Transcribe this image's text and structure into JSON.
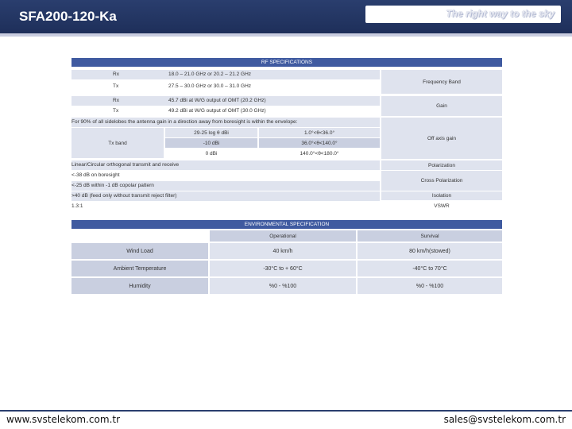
{
  "header": {
    "title": "SFA200-120-Ka",
    "slogan": "The right way to the sky"
  },
  "rf": {
    "section_title": "RF SPECIFICATIONS",
    "rx_label": "Rx",
    "rx_value": "18.0 – 21.0 GHz or 20.2 – 21.2 GHz",
    "tx_label": "Tx",
    "tx_value": "27.5 – 30.0 GHz or 30.0 – 31.0 GHz",
    "freq_band": "Frequency Band",
    "gain_rx_label": "Rx",
    "gain_rx_value": "45.7 dBi at W/G output of OMT (20.2 GHz)",
    "gain_tx_label": "Tx",
    "gain_tx_value": "49.2 dBi at W/G output of OMT (30.0 GHz)",
    "gain": "Gain",
    "envelope_note": "For 90% of all sidelobes the antenna gain in a direction away from boresight is within the envelope:",
    "tx_band": "Tx band",
    "env1_gain": "29-25 log θ dBi",
    "env1_angle": "1.0°<θ<36.0°",
    "env2_gain": "-10 dBi",
    "env2_angle": "36.0°<θ<140.0°",
    "env3_gain": "0 dBi",
    "env3_angle": "140.0°<θ<180.0°",
    "off_axis": "Off axis gain",
    "polarization_value": "Linear/Circular orthogonal transmit and receive",
    "polarization": "Polarization",
    "xpol_value1": "<-38 dB on boresight",
    "xpol_value2": "<-25 dB within -1 dB copolar pattern",
    "xpol": "Cross Polarization",
    "isolation_value": ">40 dB (feed only without transmit reject filter)",
    "isolation": "Isolation",
    "vswr_value": "1.3:1",
    "vswr": "VSWR"
  },
  "env": {
    "section_title": "ENVIRONMENTAL SPECIFICATION",
    "col_operational": "Operational",
    "col_survival": "Survival",
    "rows": [
      {
        "label": "Wind Load",
        "operational": "40 km/h",
        "survival": "80 km/h(stowed)"
      },
      {
        "label": "Ambient Temperature",
        "operational": "-30°C to + 60°C",
        "survival": "-40°C to 70°C"
      },
      {
        "label": "Humidity",
        "operational": "%0 - %100",
        "survival": "%0 - %100"
      }
    ]
  },
  "footer": {
    "website": "www.svstelekom.com.tr",
    "email": "sales@svstelekom.com.tr"
  }
}
